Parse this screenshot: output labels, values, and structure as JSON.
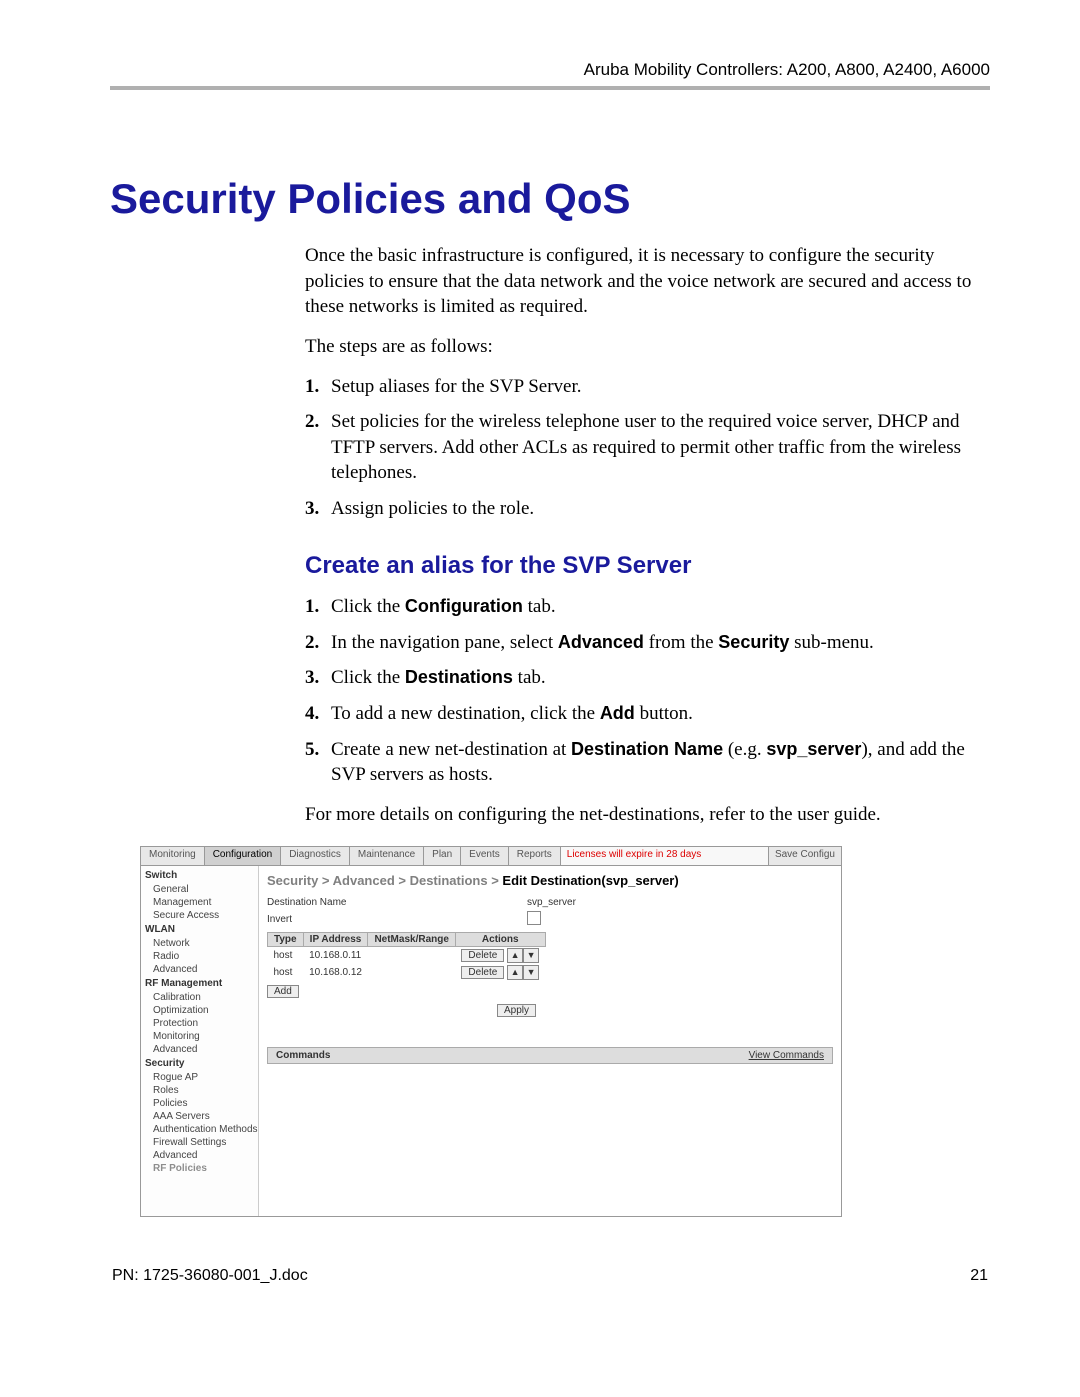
{
  "header": {
    "right_text": "Aruba Mobility Controllers: A200, A800, A2400, A6000"
  },
  "title": "Security Policies and QoS",
  "intro": "Once the basic infrastructure is configured, it is necessary to configure the security policies to ensure that the data network and the voice network are secured and access to these networks is limited as required.",
  "steps_lead": "The steps are as follows:",
  "main_steps": [
    "Setup aliases for the SVP Server.",
    "Set policies for the wireless telephone user to the required voice server, DHCP and TFTP servers.  Add other ACLs as required to permit other traffic from the wireless telephones.",
    "Assign policies to the role."
  ],
  "sub_heading": "Create an alias for the SVP Server",
  "sub_steps": [
    {
      "pre": "Click the ",
      "bold": "Configuration",
      "post": " tab."
    },
    {
      "pre": "In the navigation pane, select ",
      "bold": "Advanced",
      "mid": " from the ",
      "bold2": "Security",
      "post": " sub-menu."
    },
    {
      "pre": "Click the ",
      "bold": "Destinations",
      "post": " tab."
    },
    {
      "pre": "To add a new destination, click the ",
      "bold": "Add",
      "post": " button."
    },
    {
      "pre": "Create a new net-destination at ",
      "bold": "Destination Name",
      "mid": " (e.g. ",
      "bold2": "svp_server",
      "post": "), and add the SVP servers as hosts."
    }
  ],
  "closing": "For more details on configuring the net-destinations, refer to the user guide.",
  "screenshot": {
    "tabs": [
      "Monitoring",
      "Configuration",
      "Diagnostics",
      "Maintenance",
      "Plan",
      "Events",
      "Reports"
    ],
    "active_tab": "Configuration",
    "license": "Licenses will expire in 28 days",
    "save": "Save Configu",
    "sidebar": [
      {
        "head": "Switch",
        "items": [
          "General",
          "Management",
          "Secure Access"
        ]
      },
      {
        "head": "WLAN",
        "items": [
          "Network",
          "Radio",
          "Advanced"
        ]
      },
      {
        "head": "RF Management",
        "items": [
          "Calibration",
          "Optimization",
          "Protection",
          "Monitoring",
          "Advanced"
        ]
      },
      {
        "head": "Security",
        "items": [
          "Rogue AP",
          "Roles",
          "Policies",
          "AAA Servers",
          "Authentication Methods",
          "Firewall Settings",
          "Advanced",
          "RF Policies"
        ]
      }
    ],
    "breadcrumb": {
      "path": "Security > Advanced > Destinations > ",
      "bold": "Edit Destination(svp_server)"
    },
    "form": {
      "dest_name_label": "Destination Name",
      "dest_name_value": "svp_server",
      "invert_label": "Invert"
    },
    "table": {
      "headers": [
        "Type",
        "IP Address",
        "NetMask/Range",
        "Actions"
      ],
      "rows": [
        {
          "type": "host",
          "ip": "10.168.0.11",
          "mask": "",
          "delete": "Delete"
        },
        {
          "type": "host",
          "ip": "10.168.0.12",
          "mask": "",
          "delete": "Delete"
        }
      ]
    },
    "add_btn": "Add",
    "apply_btn": "Apply",
    "commands": {
      "left": "Commands",
      "right": "View Commands"
    }
  },
  "footer": {
    "pn": "PN: 1725-36080-001_J.doc",
    "page": "21"
  }
}
